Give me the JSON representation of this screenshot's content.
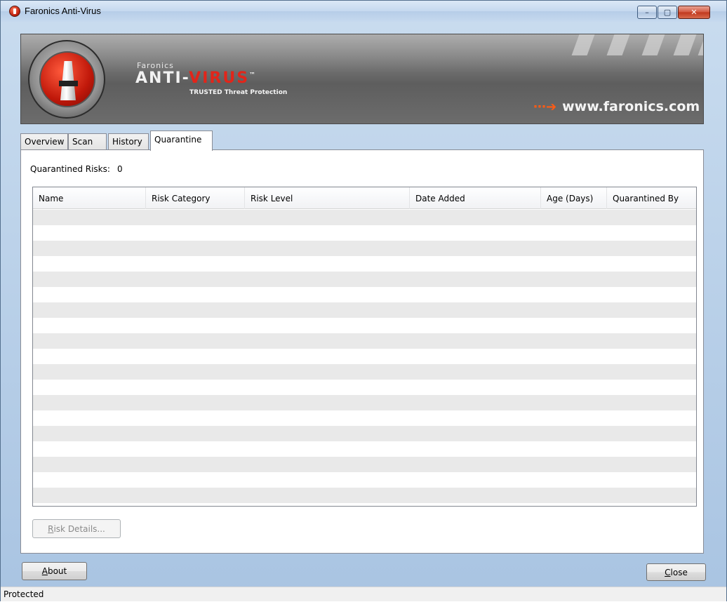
{
  "window": {
    "title": "Faronics Anti-Virus",
    "controls": {
      "minimize": "–",
      "maximize": "▢",
      "close": "✕"
    }
  },
  "banner": {
    "brand_small": "Faronics",
    "brand_anti": "ANTI-",
    "brand_virus": "VIRUS",
    "brand_tm": "™",
    "tagline": "TRUSTED Threat Protection",
    "url": "www.faronics.com",
    "url_arrow": "⋯➔"
  },
  "tabs": [
    {
      "label": "Overview"
    },
    {
      "label": "Scan"
    },
    {
      "label": "History"
    },
    {
      "label": "Quarantine",
      "active": true
    }
  ],
  "quarantine": {
    "count_label": "Quarantined Risks:",
    "count_value": "0",
    "columns": [
      "Name",
      "Risk Category",
      "Risk Level",
      "Date Added",
      "Age (Days)",
      "Quarantined By"
    ],
    "rows": []
  },
  "buttons": {
    "risk_details_prefix": "R",
    "risk_details_rest": "isk Details...",
    "about_prefix": "A",
    "about_rest": "bout",
    "close_prefix": "C",
    "close_rest": "lose"
  },
  "status": {
    "text": "Protected"
  },
  "colors": {
    "accent_red": "#e2251a",
    "url_arrow": "#ff5b14"
  }
}
